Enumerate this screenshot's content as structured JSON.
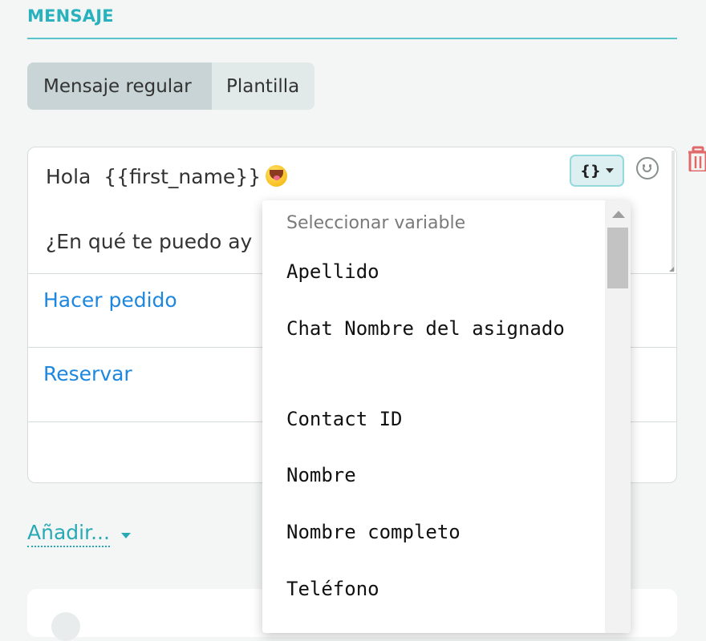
{
  "section": {
    "title": "MENSAJE"
  },
  "tabs": [
    {
      "label": "Mensaje regular",
      "active": true
    },
    {
      "label": "Plantilla",
      "active": false
    }
  ],
  "message": {
    "line1": "Hola  {{first_name}}",
    "line2": "¿En qué te puedo ay"
  },
  "toolbar": {
    "variable_button_label": "{}",
    "icons": [
      "curly-braces-icon",
      "emoji-picker-icon",
      "trash-icon"
    ]
  },
  "quick_replies": [
    {
      "label": "Hacer pedido"
    },
    {
      "label": "Reservar"
    }
  ],
  "add_button": {
    "label": "Añadir..."
  },
  "variable_dropdown": {
    "header": "Seleccionar variable",
    "items": [
      {
        "label": "Apellido"
      },
      {
        "label": "Chat Nombre del asignado"
      },
      {
        "label": "Contact ID"
      },
      {
        "label": "Nombre"
      },
      {
        "label": "Nombre completo"
      },
      {
        "label": "Teléfono"
      }
    ]
  },
  "colors": {
    "accent": "#28b2bd",
    "link": "#1d87e0",
    "danger": "#e06a6a"
  }
}
